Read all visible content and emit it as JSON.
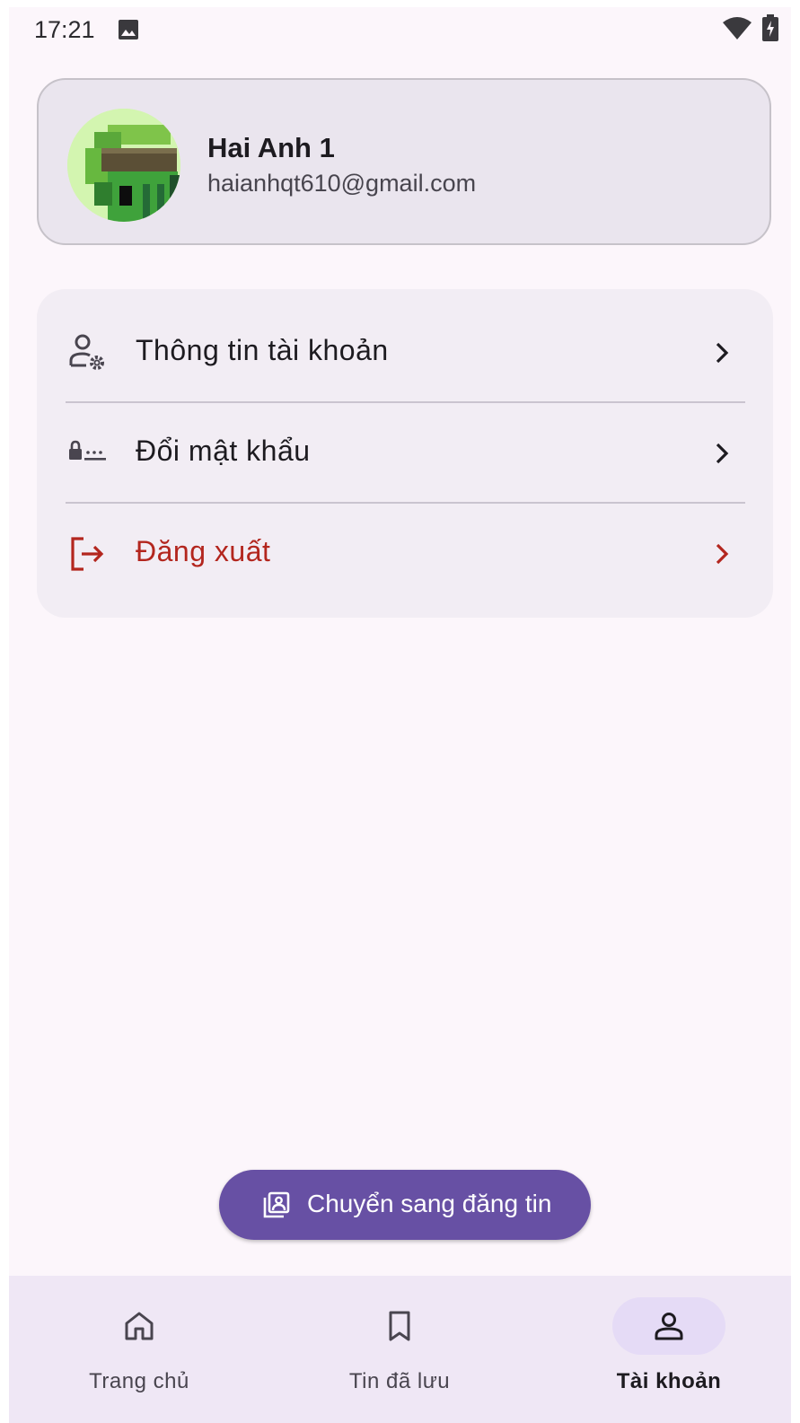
{
  "status_bar": {
    "time": "17:21"
  },
  "profile": {
    "name": "Hai Anh 1",
    "email": "haianhqt610@gmail.com"
  },
  "menu": {
    "items": [
      {
        "label": "Thông tin tài khoản",
        "icon": "account-settings-icon"
      },
      {
        "label": "Đổi mật khẩu",
        "icon": "password-icon"
      },
      {
        "label": "Đăng xuất",
        "icon": "logout-icon",
        "color": "#b3261e"
      }
    ]
  },
  "fab": {
    "label": "Chuyển sang đăng tin",
    "icon": "portrait-gallery-icon",
    "color": "#6750a4"
  },
  "bottom_nav": {
    "items": [
      {
        "label": "Trang chủ",
        "icon": "home-icon"
      },
      {
        "label": "Tin đã lưu",
        "icon": "bookmark-icon"
      },
      {
        "label": "Tài khoản",
        "icon": "person-icon",
        "active": true
      }
    ]
  },
  "colors": {
    "background": "#fcf6fb",
    "accent": "#6750a4",
    "danger": "#b3261e",
    "nav_background": "#efe7f5"
  }
}
